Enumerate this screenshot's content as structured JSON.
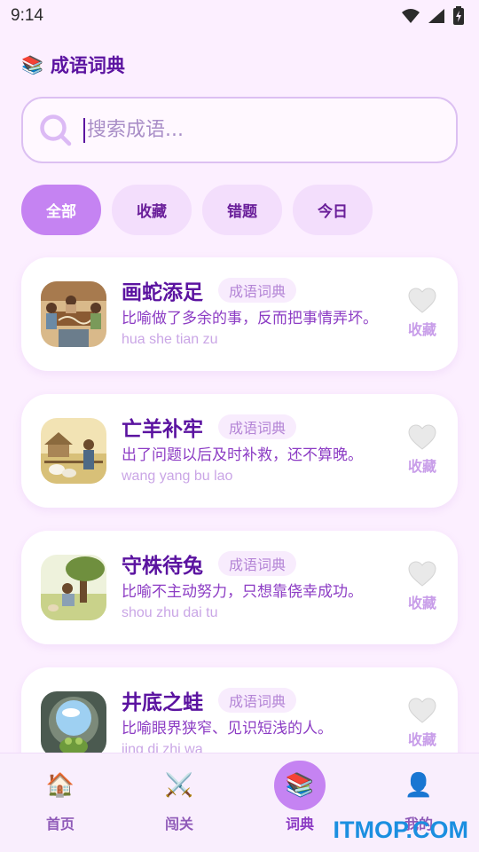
{
  "status_bar": {
    "time": "9:14"
  },
  "header": {
    "logo_icon": "books-icon",
    "title": "成语词典"
  },
  "search": {
    "placeholder": "搜索成语..."
  },
  "filters": [
    {
      "label": "全部",
      "active": true
    },
    {
      "label": "收藏",
      "active": false
    },
    {
      "label": "错题",
      "active": false
    },
    {
      "label": "今日",
      "active": false
    }
  ],
  "idioms": [
    {
      "name": "画蛇添足",
      "tag": "成语词典",
      "meaning": "比喻做了多余的事，反而把事情弄坏。",
      "pinyin": "hua she tian zu",
      "fav_label": "收藏",
      "favorited": false
    },
    {
      "name": "亡羊补牢",
      "tag": "成语词典",
      "meaning": "出了问题以后及时补救，还不算晚。",
      "pinyin": "wang yang bu lao",
      "fav_label": "收藏",
      "favorited": false
    },
    {
      "name": "守株待兔",
      "tag": "成语词典",
      "meaning": "比喻不主动努力，只想靠侥幸成功。",
      "pinyin": "shou zhu dai tu",
      "fav_label": "收藏",
      "favorited": false
    },
    {
      "name": "井底之蛙",
      "tag": "成语词典",
      "meaning": "比喻眼界狭窄、见识短浅的人。",
      "pinyin": "jing di zhi wa",
      "fav_label": "收藏",
      "favorited": false
    }
  ],
  "bottom_nav": [
    {
      "label": "首页",
      "icon": "house-icon",
      "active": false
    },
    {
      "label": "闯关",
      "icon": "crossed-swords-icon",
      "active": false
    },
    {
      "label": "词典",
      "icon": "books-icon",
      "active": true
    },
    {
      "label": "我的",
      "icon": "user-icon",
      "active": false
    }
  ],
  "watermark": "ITMOP.COM",
  "colors": {
    "accent": "#c583f2",
    "text_primary": "#5b13a0",
    "background": "#fcefff"
  }
}
